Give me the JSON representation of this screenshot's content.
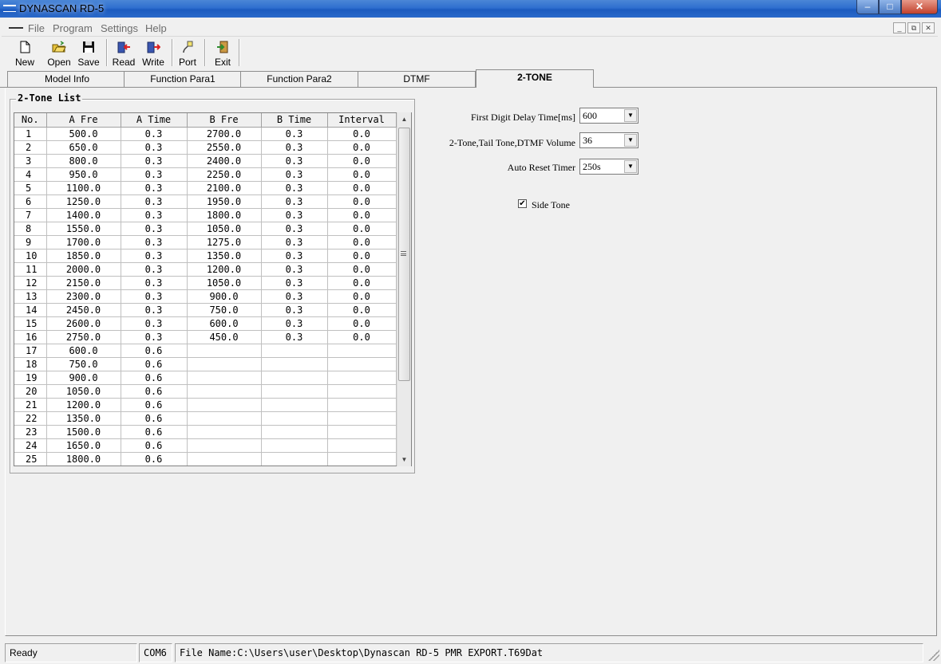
{
  "window": {
    "title": "DYNASCAN RD-5",
    "controls": [
      "minimize",
      "maximize",
      "close"
    ]
  },
  "menu": {
    "items": [
      "File",
      "Program",
      "Settings",
      "Help"
    ]
  },
  "toolbar": {
    "buttons": [
      {
        "label": "New",
        "icon": "new-file-icon"
      },
      {
        "label": "Open",
        "icon": "open-folder-icon"
      },
      {
        "label": "Save",
        "icon": "save-disk-icon"
      },
      {
        "label": "Read",
        "icon": "read-radio-icon"
      },
      {
        "label": "Write",
        "icon": "write-radio-icon"
      },
      {
        "label": "Port",
        "icon": "port-plug-icon"
      },
      {
        "label": "Exit",
        "icon": "exit-door-icon"
      }
    ]
  },
  "tabs": [
    {
      "label": "Model Info",
      "active": false
    },
    {
      "label": "Function Para1",
      "active": false
    },
    {
      "label": "Function Para2",
      "active": false
    },
    {
      "label": "DTMF",
      "active": false
    },
    {
      "label": "2-TONE",
      "active": true
    }
  ],
  "two_tone_list": {
    "title": "2-Tone List",
    "columns": [
      "No.",
      "A Fre",
      "A Time",
      "B Fre",
      "B Time",
      "Interval"
    ],
    "rows": [
      [
        "1",
        "500.0",
        "0.3",
        "2700.0",
        "0.3",
        "0.0"
      ],
      [
        "2",
        "650.0",
        "0.3",
        "2550.0",
        "0.3",
        "0.0"
      ],
      [
        "3",
        "800.0",
        "0.3",
        "2400.0",
        "0.3",
        "0.0"
      ],
      [
        "4",
        "950.0",
        "0.3",
        "2250.0",
        "0.3",
        "0.0"
      ],
      [
        "5",
        "1100.0",
        "0.3",
        "2100.0",
        "0.3",
        "0.0"
      ],
      [
        "6",
        "1250.0",
        "0.3",
        "1950.0",
        "0.3",
        "0.0"
      ],
      [
        "7",
        "1400.0",
        "0.3",
        "1800.0",
        "0.3",
        "0.0"
      ],
      [
        "8",
        "1550.0",
        "0.3",
        "1050.0",
        "0.3",
        "0.0"
      ],
      [
        "9",
        "1700.0",
        "0.3",
        "1275.0",
        "0.3",
        "0.0"
      ],
      [
        "10",
        "1850.0",
        "0.3",
        "1350.0",
        "0.3",
        "0.0"
      ],
      [
        "11",
        "2000.0",
        "0.3",
        "1200.0",
        "0.3",
        "0.0"
      ],
      [
        "12",
        "2150.0",
        "0.3",
        "1050.0",
        "0.3",
        "0.0"
      ],
      [
        "13",
        "2300.0",
        "0.3",
        "900.0",
        "0.3",
        "0.0"
      ],
      [
        "14",
        "2450.0",
        "0.3",
        "750.0",
        "0.3",
        "0.0"
      ],
      [
        "15",
        "2600.0",
        "0.3",
        "600.0",
        "0.3",
        "0.0"
      ],
      [
        "16",
        "2750.0",
        "0.3",
        "450.0",
        "0.3",
        "0.0"
      ],
      [
        "17",
        "600.0",
        "0.6",
        "",
        "",
        ""
      ],
      [
        "18",
        "750.0",
        "0.6",
        "",
        "",
        ""
      ],
      [
        "19",
        "900.0",
        "0.6",
        "",
        "",
        ""
      ],
      [
        "20",
        "1050.0",
        "0.6",
        "",
        "",
        ""
      ],
      [
        "21",
        "1200.0",
        "0.6",
        "",
        "",
        ""
      ],
      [
        "22",
        "1350.0",
        "0.6",
        "",
        "",
        ""
      ],
      [
        "23",
        "1500.0",
        "0.6",
        "",
        "",
        ""
      ],
      [
        "24",
        "1650.0",
        "0.6",
        "",
        "",
        ""
      ],
      [
        "25",
        "1800.0",
        "0.6",
        "",
        "",
        ""
      ]
    ]
  },
  "settings": {
    "first_digit_delay": {
      "label": "First Digit Delay Time[ms]",
      "value": "600"
    },
    "volume": {
      "label": "2-Tone,Tail Tone,DTMF Volume",
      "value": "36"
    },
    "auto_reset": {
      "label": "Auto Reset Timer",
      "value": "250s"
    },
    "side_tone": {
      "label": "Side Tone",
      "checked": true
    }
  },
  "statusbar": {
    "status": "Ready",
    "port": "COM6",
    "file": "File Name:C:\\Users\\user\\Desktop\\Dynascan RD-5 PMR EXPORT.T69Dat"
  }
}
